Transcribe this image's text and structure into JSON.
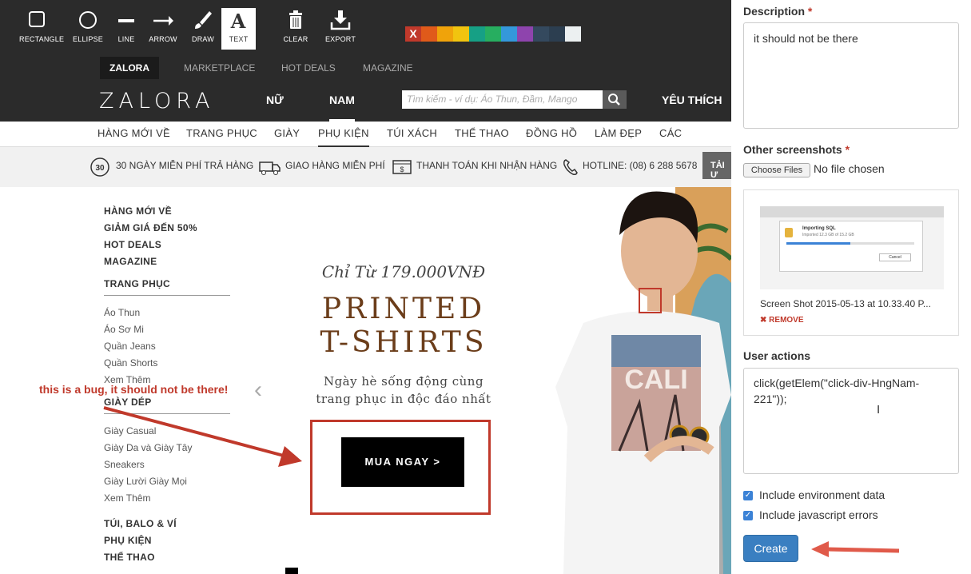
{
  "toolbar": {
    "tools": [
      {
        "label": "RECTANGLE",
        "icon": "rectangle-icon"
      },
      {
        "label": "ELLIPSE",
        "icon": "ellipse-icon"
      },
      {
        "label": "LINE",
        "icon": "line-icon"
      },
      {
        "label": "ARROW",
        "icon": "arrow-icon"
      },
      {
        "label": "DRAW",
        "icon": "brush-icon"
      },
      {
        "label": "TEXT",
        "icon": "text-icon"
      },
      {
        "label": "CLEAR",
        "icon": "trash-icon"
      },
      {
        "label": "EXPORT",
        "icon": "download-icon"
      }
    ],
    "active_tool": "TEXT",
    "swatches": [
      "#c0392b",
      "#e05a1a",
      "#f0a30a",
      "#f1c40f",
      "#16a085",
      "#27ae60",
      "#3498db",
      "#8e44ad",
      "#34495e",
      "#2c3e50",
      "#ecf0f1"
    ],
    "swatch_clear_label": "X"
  },
  "site": {
    "top_tabs": [
      "ZALORA",
      "MARKETPLACE",
      "HOT DEALS",
      "MAGAZINE"
    ],
    "logo": "ZALORA",
    "genders": [
      "NỮ",
      "NAM"
    ],
    "search_placeholder": "Tìm kiếm - ví dụ: Áo Thun, Đầm, Mango",
    "favorites": "YÊU THÍCH",
    "categories": [
      "HÀNG MỚI VỀ",
      "TRANG PHỤC",
      "GIÀY",
      "PHỤ KIỆN",
      "TÚI XÁCH",
      "THỂ THAO",
      "ĐỒNG HỒ",
      "LÀM ĐẸP",
      "CÁC THƯƠNG"
    ],
    "usp": [
      "30 NGÀY MIỄN PHÍ TRẢ HÀNG",
      "GIAO HÀNG MIỄN PHÍ",
      "THANH TOÁN KHI NHẬN HÀNG",
      "HOTLINE: (08) 6 288 5678"
    ],
    "usp_badge": "30",
    "app_button": "TẢI Ư"
  },
  "menu": {
    "top": [
      "HÀNG MỚI VỀ",
      "GIẢM GIÁ ĐẾN 50%",
      "HOT DEALS",
      "MAGAZINE"
    ],
    "trang_phuc_title": "TRANG PHỤC",
    "trang_phuc": [
      "Áo Thun",
      "Áo Sơ Mi",
      "Quần Jeans",
      "Quần Shorts",
      "Xem Thêm"
    ],
    "giay_dep_title": "GIÀY DÉP",
    "giay_dep": [
      "Giày Casual",
      "Giày Da và Giày Tây",
      "Sneakers",
      "Giày Lười Giày Mọi",
      "Xem Thêm"
    ],
    "bottom": [
      "TÚI, BALO & VÍ",
      "PHỤ KIỆN",
      "THỂ THAO"
    ]
  },
  "promo": {
    "subtitle": "Chỉ Từ 179.000VNĐ",
    "title_line1": "PRINTED",
    "title_line2": "T-SHIRTS",
    "desc_line1": "Ngày hè sống động cùng",
    "desc_line2": "trang phục in độc đáo nhất",
    "button": "MUA NGAY >",
    "shirt_text": "CALI"
  },
  "annotation": {
    "bug_text": "this is a bug, it should not be there!"
  },
  "form": {
    "description_label": "Description",
    "description_value": "it should not be there",
    "screenshots_label": "Other screenshots",
    "choose_files": "Choose Files",
    "no_file": "No file chosen",
    "shot_name": "Screen Shot 2015-05-13 at 10.33.40 P...",
    "remove": "REMOVE",
    "shot_dialog_title": "Importing SQL",
    "shot_dialog_text": "Imported 12.3 GB of 15.2 GB",
    "shot_cancel": "Cancel",
    "user_actions_label": "User actions",
    "user_actions_value": "click(getElem(\"click-div-HngNam-221\"));",
    "include_env": "Include environment data",
    "include_js": "Include javascript errors",
    "create": "Create",
    "required_mark": "*"
  }
}
